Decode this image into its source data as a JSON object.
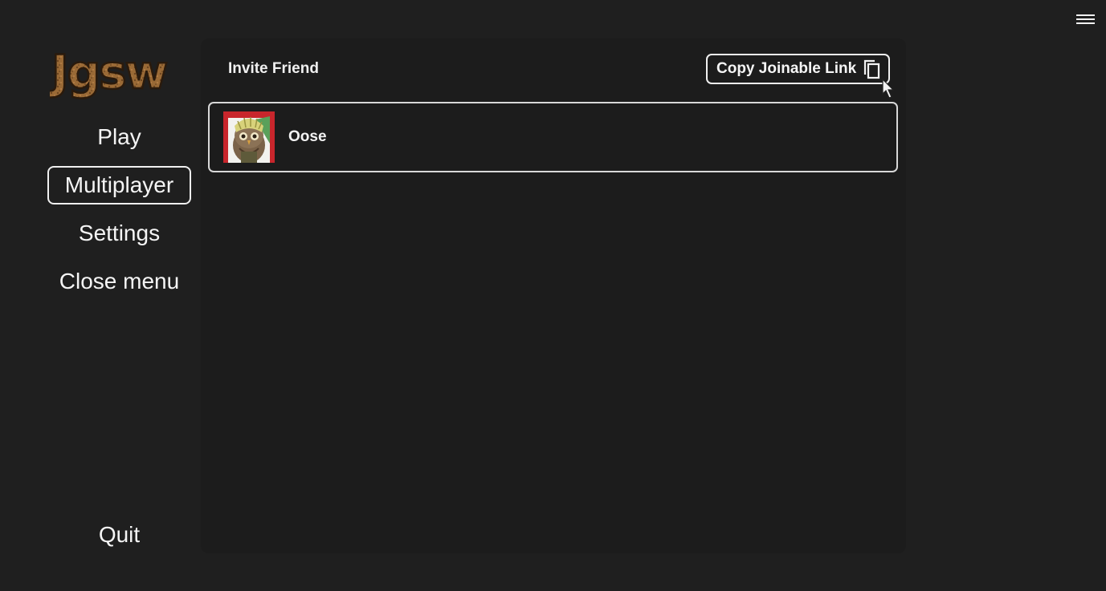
{
  "header": {
    "menu_icon": "hamburger-menu-icon"
  },
  "logo": {
    "text": "Jgsw",
    "color": "#8a5a2b"
  },
  "nav": {
    "items": [
      {
        "label": "Play"
      },
      {
        "label": "Multiplayer",
        "active": true
      },
      {
        "label": "Settings"
      },
      {
        "label": "Close menu"
      }
    ],
    "quit_label": "Quit"
  },
  "panel": {
    "title": "Invite Friend",
    "copy_link_label": "Copy Joinable Link",
    "copy_icon": "copy-icon",
    "friends": [
      {
        "name": "Oose",
        "avatar_icon": "owl-avatar"
      }
    ]
  },
  "colors": {
    "background": "#1f1f1f",
    "panel": "#1c1c1c",
    "text": "#f2f2f2",
    "border": "#f0f0f0",
    "avatar_bg": "#c8262c"
  }
}
